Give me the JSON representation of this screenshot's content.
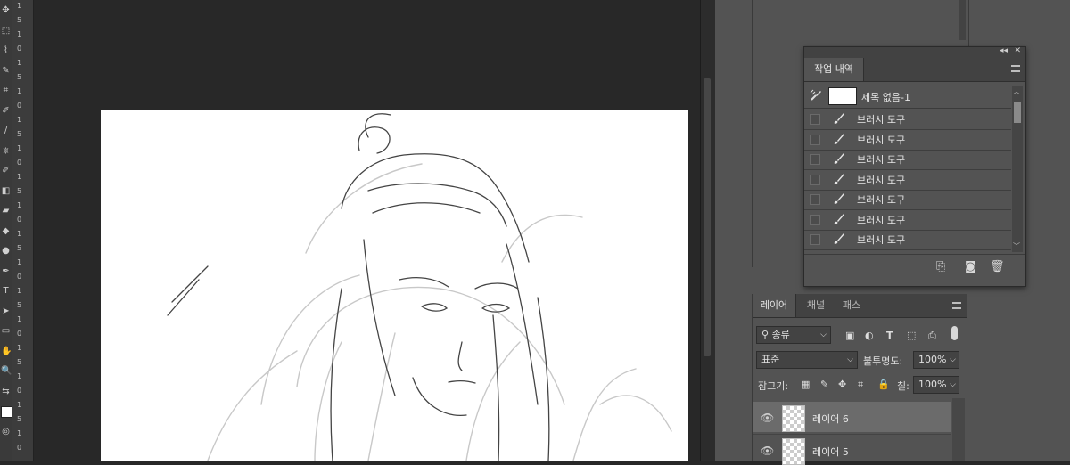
{
  "toolbar": {
    "tools": [
      "move-tool",
      "marquee-tool",
      "lasso-tool",
      "quick-select-tool",
      "crop-tool",
      "eyedropper-tool",
      "brush-tool",
      "clone-stamp-tool",
      "history-brush-tool",
      "eraser-tool",
      "gradient-tool",
      "blur-tool",
      "dodge-tool",
      "pen-tool",
      "type-tool",
      "path-select-tool",
      "shape-tool",
      "hand-tool",
      "zoom-tool",
      "swap-colors",
      "foreground-color",
      "quick-mask"
    ]
  },
  "ruler": {
    "marks": [
      "1",
      "5",
      "1",
      "0",
      "1",
      "5",
      "1",
      "0",
      "1",
      "5",
      "1",
      "0",
      "1",
      "5",
      "1",
      "0",
      "1",
      "5",
      "1",
      "0",
      "1",
      "5",
      "1",
      "0",
      "1",
      "5",
      "1",
      "0",
      "1",
      "5",
      "1",
      "0"
    ]
  },
  "history_panel": {
    "tab_label": "작업 내역",
    "snapshot_label": "제목 없음-1",
    "items": [
      "브러시 도구",
      "브러시 도구",
      "브러시 도구",
      "브러시 도구",
      "브러시 도구",
      "브러시 도구",
      "브러시 도구"
    ],
    "footer_icons": [
      "new-document-icon",
      "camera-icon",
      "trash-icon"
    ]
  },
  "layers_panel": {
    "tabs": [
      "레이어",
      "채널",
      "패스"
    ],
    "filter_label": "종류",
    "blend_mode": "표준",
    "opacity_label": "불투명도:",
    "opacity_value": "100%",
    "lock_label": "잠그기:",
    "fill_label": "칠:",
    "fill_value": "100%",
    "layers": [
      {
        "name": "레이어 6",
        "selected": true
      },
      {
        "name": "레이어 5",
        "selected": false
      }
    ]
  },
  "colors": {
    "panel": "#535353",
    "panel_dark": "#424242",
    "workspace": "#282828",
    "selected_layer": "#6b6b6b"
  }
}
